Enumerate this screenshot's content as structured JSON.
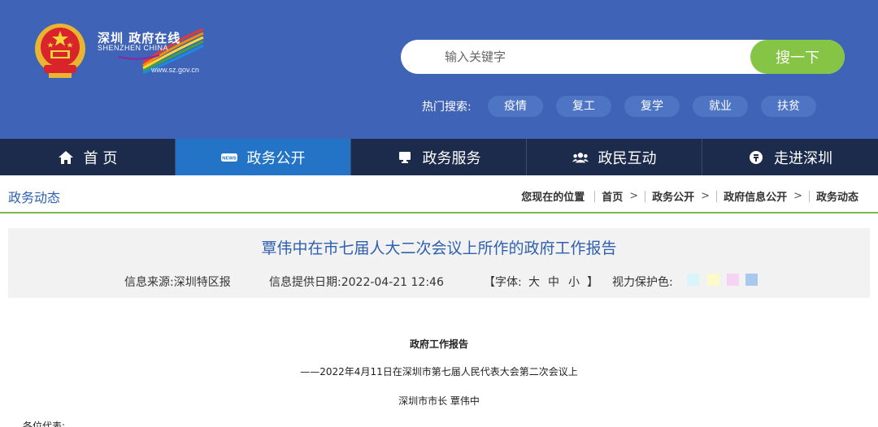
{
  "header": {
    "logo_cn": "深圳 政府在线",
    "logo_en": "SHENZHEN CHINA",
    "logo_url": "www.sz.gov.cn",
    "search": {
      "placeholder": "输入关键字",
      "button": "搜一下"
    },
    "hot_label": "热门搜索:",
    "hot_tags": [
      "疫情",
      "复工",
      "复学",
      "就业",
      "扶贫"
    ]
  },
  "nav": [
    {
      "label": "首 页",
      "icon": "home-icon"
    },
    {
      "label": "政务公开",
      "icon": "news-icon"
    },
    {
      "label": "政务服务",
      "icon": "monitor-icon"
    },
    {
      "label": "政民互动",
      "icon": "people-icon"
    },
    {
      "label": "走进深圳",
      "icon": "info-icon"
    }
  ],
  "breadcrumb": {
    "section_title": "政务动态",
    "prefix": "您现在的位置",
    "items": [
      "首页",
      "政务公开",
      "政府信息公开",
      "政务动态"
    ]
  },
  "article": {
    "title": "覃伟中在市七届人大二次会议上所作的政府工作报告",
    "source": "信息来源:深圳特区报",
    "date": "信息提供日期:2022-04-21 12:46",
    "font_open": "【字体:",
    "font_sizes": [
      "大",
      "中",
      "小"
    ],
    "font_close": "】",
    "eye_label": "视力保护色:",
    "eye_colors": [
      "#d9f4fb",
      "#fbfbc9",
      "#f6d3f3",
      "#a8c8ee"
    ]
  },
  "content": {
    "heading": "政府工作报告",
    "subtitle": "——2022年4月11日在深圳市第七届人民代表大会第二次会议上",
    "author": "深圳市市长 覃伟中",
    "opening": "各位代表:"
  },
  "colors": {
    "header_bg": "#3f63b6",
    "nav_bg": "#1c2b4b",
    "nav_active": "#2374c7",
    "search_button": "#86c445",
    "title_blue": "#2e5fb0"
  }
}
